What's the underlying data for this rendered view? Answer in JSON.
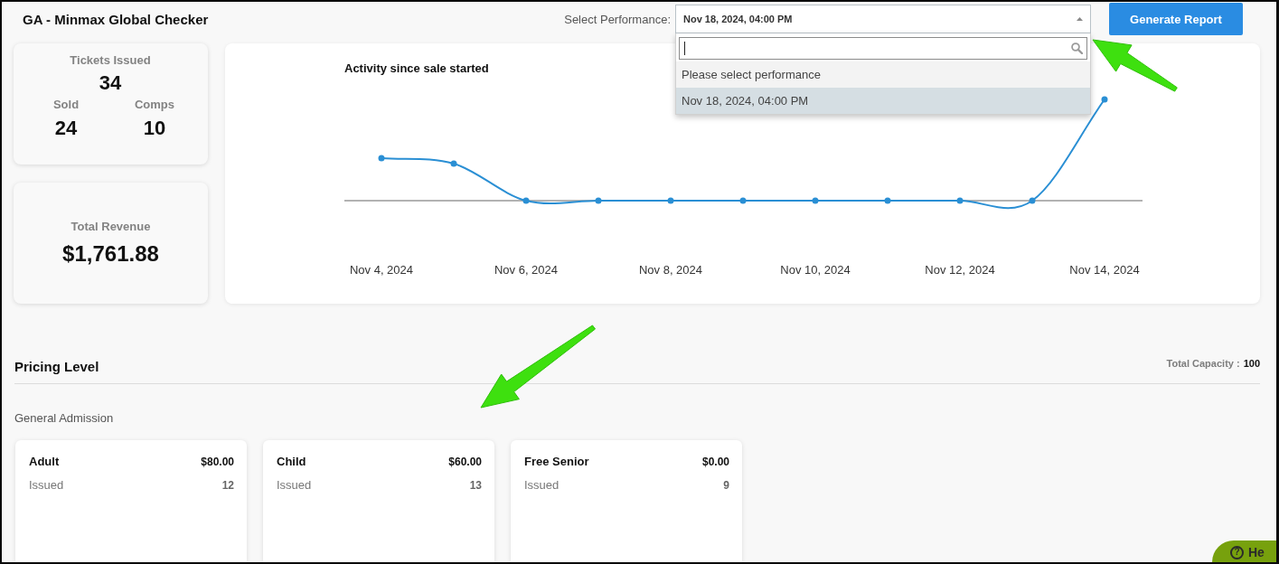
{
  "header": {
    "title": "GA - Minmax Global Checker",
    "select_label": "Select Performance:",
    "select": {
      "value": "Nov 18, 2024, 04:00 PM",
      "expanded": true,
      "search": {
        "focused": true
      },
      "options": [
        {
          "label": "Please select performance",
          "selected": false
        },
        {
          "label": "Nov 18, 2024, 04:00 PM",
          "selected": true
        }
      ]
    },
    "button": "Generate Report"
  },
  "tickets": {
    "label": "Tickets Issued",
    "value": "34",
    "breakdown": [
      {
        "label": "Sold",
        "value": "24"
      },
      {
        "label": "Comps",
        "value": "10"
      }
    ]
  },
  "revenue": {
    "label": "Total Revenue",
    "value": "$1,761.88"
  },
  "chart": {
    "title": "Activity since sale started",
    "x_labels": [
      "Nov 4, 2024",
      "Nov 6, 2024",
      "Nov 8, 2024",
      "Nov 10, 2024",
      "Nov 12, 2024",
      "Nov 14, 2024"
    ]
  },
  "pricing": {
    "title": "Pricing Level",
    "capacity_label": "Total Capacity :",
    "capacity_value": "100",
    "group": "General Admission",
    "levels": [
      {
        "name": "Adult",
        "price": "$80.00",
        "stat_label": "Issued",
        "issued": "12"
      },
      {
        "name": "Child",
        "price": "$60.00",
        "stat_label": "Issued",
        "issued": "13"
      },
      {
        "name": "Free Senior",
        "price": "$0.00",
        "stat_label": "Issued",
        "issued": "9"
      }
    ]
  },
  "help": {
    "icon": "?",
    "label": "He"
  }
}
